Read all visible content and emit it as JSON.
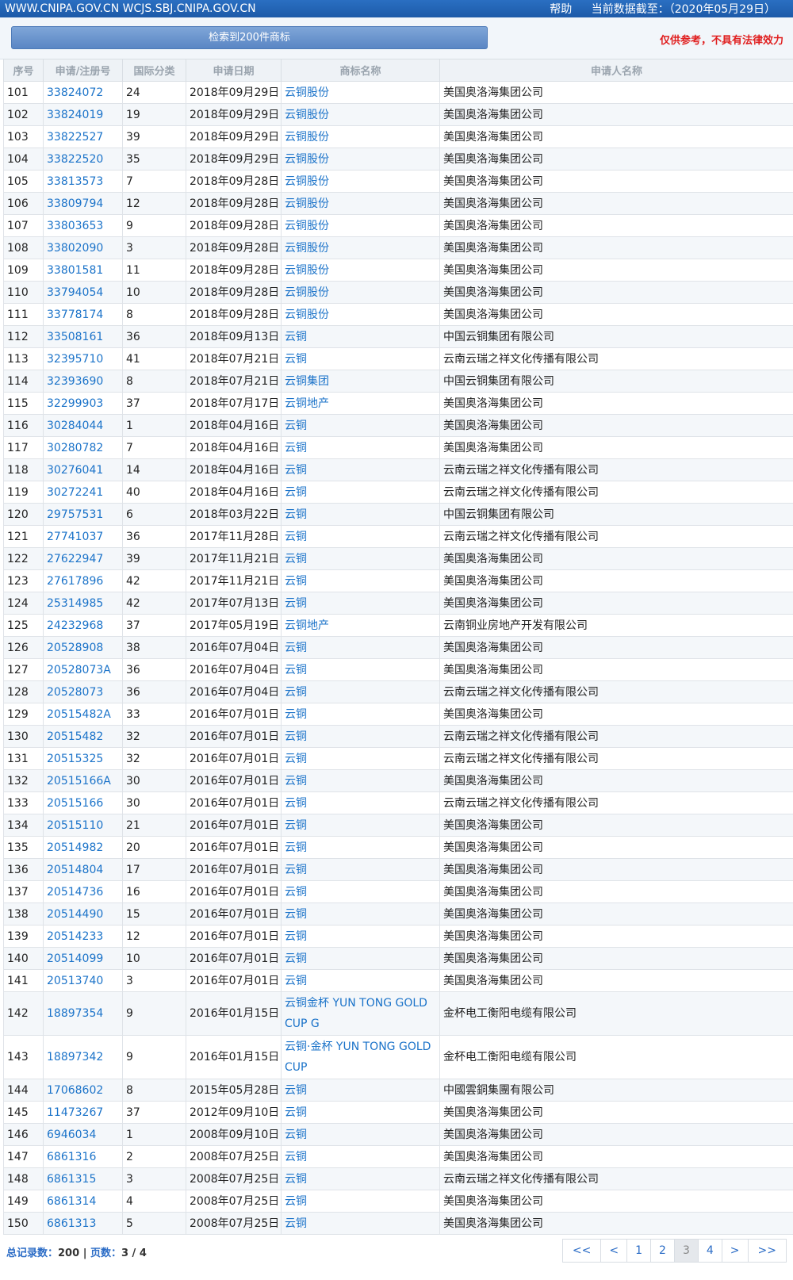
{
  "header": {
    "site": "WWW.CNIPA.GOV.CN WCJS.SBJ.CNIPA.GOV.CN",
    "help": "帮助",
    "data_date": "当前数据截至：（2020年05月29日）"
  },
  "search": {
    "result_label": "检索到200件商标",
    "disclaimer": "仅供参考，不具有法律效力"
  },
  "table": {
    "headers": [
      "序号",
      "申请/注册号",
      "国际分类",
      "申请日期",
      "商标名称",
      "申请人名称"
    ],
    "rows": [
      [
        "101",
        "33824072",
        "24",
        "2018年09月29日",
        "云铜股份",
        "美国奥洛海集团公司"
      ],
      [
        "102",
        "33824019",
        "19",
        "2018年09月29日",
        "云铜股份",
        "美国奥洛海集团公司"
      ],
      [
        "103",
        "33822527",
        "39",
        "2018年09月29日",
        "云铜股份",
        "美国奥洛海集团公司"
      ],
      [
        "104",
        "33822520",
        "35",
        "2018年09月29日",
        "云铜股份",
        "美国奥洛海集团公司"
      ],
      [
        "105",
        "33813573",
        "7",
        "2018年09月28日",
        "云铜股份",
        "美国奥洛海集团公司"
      ],
      [
        "106",
        "33809794",
        "12",
        "2018年09月28日",
        "云铜股份",
        "美国奥洛海集团公司"
      ],
      [
        "107",
        "33803653",
        "9",
        "2018年09月28日",
        "云铜股份",
        "美国奥洛海集团公司"
      ],
      [
        "108",
        "33802090",
        "3",
        "2018年09月28日",
        "云铜股份",
        "美国奥洛海集团公司"
      ],
      [
        "109",
        "33801581",
        "11",
        "2018年09月28日",
        "云铜股份",
        "美国奥洛海集团公司"
      ],
      [
        "110",
        "33794054",
        "10",
        "2018年09月28日",
        "云铜股份",
        "美国奥洛海集团公司"
      ],
      [
        "111",
        "33778174",
        "8",
        "2018年09月28日",
        "云铜股份",
        "美国奥洛海集团公司"
      ],
      [
        "112",
        "33508161",
        "36",
        "2018年09月13日",
        "云铜",
        "中国云铜集团有限公司"
      ],
      [
        "113",
        "32395710",
        "41",
        "2018年07月21日",
        "云铜",
        "云南云瑞之祥文化传播有限公司"
      ],
      [
        "114",
        "32393690",
        "8",
        "2018年07月21日",
        "云铜集团",
        "中国云铜集团有限公司"
      ],
      [
        "115",
        "32299903",
        "37",
        "2018年07月17日",
        "云铜地产",
        "美国奥洛海集团公司"
      ],
      [
        "116",
        "30284044",
        "1",
        "2018年04月16日",
        "云铜",
        "美国奥洛海集团公司"
      ],
      [
        "117",
        "30280782",
        "7",
        "2018年04月16日",
        "云铜",
        "美国奥洛海集团公司"
      ],
      [
        "118",
        "30276041",
        "14",
        "2018年04月16日",
        "云铜",
        "云南云瑞之祥文化传播有限公司"
      ],
      [
        "119",
        "30272241",
        "40",
        "2018年04月16日",
        "云铜",
        "云南云瑞之祥文化传播有限公司"
      ],
      [
        "120",
        "29757531",
        "6",
        "2018年03月22日",
        "云铜",
        "中国云铜集团有限公司"
      ],
      [
        "121",
        "27741037",
        "36",
        "2017年11月28日",
        "云铜",
        "云南云瑞之祥文化传播有限公司"
      ],
      [
        "122",
        "27622947",
        "39",
        "2017年11月21日",
        "云铜",
        "美国奥洛海集团公司"
      ],
      [
        "123",
        "27617896",
        "42",
        "2017年11月21日",
        "云铜",
        "美国奥洛海集团公司"
      ],
      [
        "124",
        "25314985",
        "42",
        "2017年07月13日",
        "云铜",
        "美国奥洛海集团公司"
      ],
      [
        "125",
        "24232968",
        "37",
        "2017年05月19日",
        "云铜地产",
        "云南铜业房地产开发有限公司"
      ],
      [
        "126",
        "20528908",
        "38",
        "2016年07月04日",
        "云铜",
        "美国奥洛海集团公司"
      ],
      [
        "127",
        "20528073A",
        "36",
        "2016年07月04日",
        "云铜",
        "美国奥洛海集团公司"
      ],
      [
        "128",
        "20528073",
        "36",
        "2016年07月04日",
        "云铜",
        "云南云瑞之祥文化传播有限公司"
      ],
      [
        "129",
        "20515482A",
        "33",
        "2016年07月01日",
        "云铜",
        "美国奥洛海集团公司"
      ],
      [
        "130",
        "20515482",
        "32",
        "2016年07月01日",
        "云铜",
        "云南云瑞之祥文化传播有限公司"
      ],
      [
        "131",
        "20515325",
        "32",
        "2016年07月01日",
        "云铜",
        "云南云瑞之祥文化传播有限公司"
      ],
      [
        "132",
        "20515166A",
        "30",
        "2016年07月01日",
        "云铜",
        "美国奥洛海集团公司"
      ],
      [
        "133",
        "20515166",
        "30",
        "2016年07月01日",
        "云铜",
        "云南云瑞之祥文化传播有限公司"
      ],
      [
        "134",
        "20515110",
        "21",
        "2016年07月01日",
        "云铜",
        "美国奥洛海集团公司"
      ],
      [
        "135",
        "20514982",
        "20",
        "2016年07月01日",
        "云铜",
        "美国奥洛海集团公司"
      ],
      [
        "136",
        "20514804",
        "17",
        "2016年07月01日",
        "云铜",
        "美国奥洛海集团公司"
      ],
      [
        "137",
        "20514736",
        "16",
        "2016年07月01日",
        "云铜",
        "美国奥洛海集团公司"
      ],
      [
        "138",
        "20514490",
        "15",
        "2016年07月01日",
        "云铜",
        "美国奥洛海集团公司"
      ],
      [
        "139",
        "20514233",
        "12",
        "2016年07月01日",
        "云铜",
        "美国奥洛海集团公司"
      ],
      [
        "140",
        "20514099",
        "10",
        "2016年07月01日",
        "云铜",
        "美国奥洛海集团公司"
      ],
      [
        "141",
        "20513740",
        "3",
        "2016年07月01日",
        "云铜",
        "美国奥洛海集团公司"
      ],
      [
        "142",
        "18897354",
        "9",
        "2016年01月15日",
        "云铜金杯 YUN TONG GOLD CUP G",
        "金杯电工衡阳电缆有限公司"
      ],
      [
        "143",
        "18897342",
        "9",
        "2016年01月15日",
        "云铜·金杯 YUN TONG GOLD CUP",
        "金杯电工衡阳电缆有限公司"
      ],
      [
        "144",
        "17068602",
        "8",
        "2015年05月28日",
        "云铜",
        "中國雲銅集團有限公司"
      ],
      [
        "145",
        "11473267",
        "37",
        "2012年09月10日",
        "云铜",
        "美国奥洛海集团公司"
      ],
      [
        "146",
        "6946034",
        "1",
        "2008年09月10日",
        "云铜",
        "美国奥洛海集团公司"
      ],
      [
        "147",
        "6861316",
        "2",
        "2008年07月25日",
        "云铜",
        "美国奥洛海集团公司"
      ],
      [
        "148",
        "6861315",
        "3",
        "2008年07月25日",
        "云铜",
        "云南云瑞之祥文化传播有限公司"
      ],
      [
        "149",
        "6861314",
        "4",
        "2008年07月25日",
        "云铜",
        "美国奥洛海集团公司"
      ],
      [
        "150",
        "6861313",
        "5",
        "2008年07月25日",
        "云铜",
        "美国奥洛海集团公司"
      ]
    ]
  },
  "footer": {
    "total_label": "总记录数：",
    "total_value": "200",
    "separator": "|",
    "page_label": "页数：",
    "page_value": "3 / 4"
  },
  "pager": {
    "first": "<<",
    "prev": "<",
    "pages": [
      "1",
      "2",
      "3",
      "4"
    ],
    "current": "3",
    "next": ">",
    "last": ">>"
  }
}
